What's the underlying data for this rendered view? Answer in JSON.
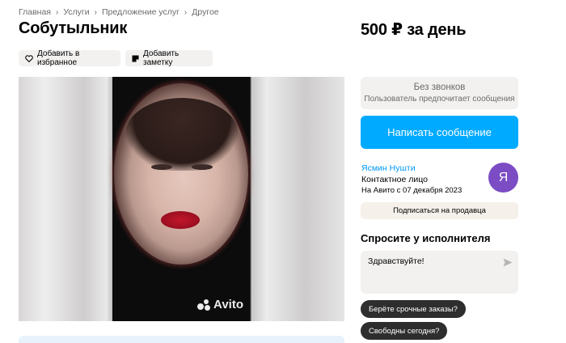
{
  "breadcrumb": {
    "items": [
      "Главная",
      "Услуги",
      "Предложение услуг",
      "Другое"
    ],
    "separator": "›"
  },
  "listing": {
    "title": "Собутыльник",
    "price": "500 ₽ за день"
  },
  "actions": {
    "favorite_label": "Добавить в избранное",
    "note_label": "Добавить заметку"
  },
  "media": {
    "watermark": "Avito"
  },
  "contact": {
    "no_calls_title": "Без звонков",
    "no_calls_sub": "Пользователь предпочитает сообщения",
    "message_button": "Написать сообщение"
  },
  "seller": {
    "name": "Ясмин Нушти",
    "role": "Контактное лицо",
    "since": "На Авито с 07 декабря 2023",
    "avatar_letter": "Я",
    "subscribe_label": "Подписаться на продавца"
  },
  "ask": {
    "title": "Спросите у исполнителя",
    "input_value": "Здравствуйте!",
    "quick_questions": [
      "Берёте срочные заказы?",
      "Свободны сегодня?"
    ]
  },
  "colors": {
    "accent": "#00aaff",
    "link": "#0099f7",
    "avatar": "#7b4cc4",
    "chip": "#2e2e2e"
  }
}
